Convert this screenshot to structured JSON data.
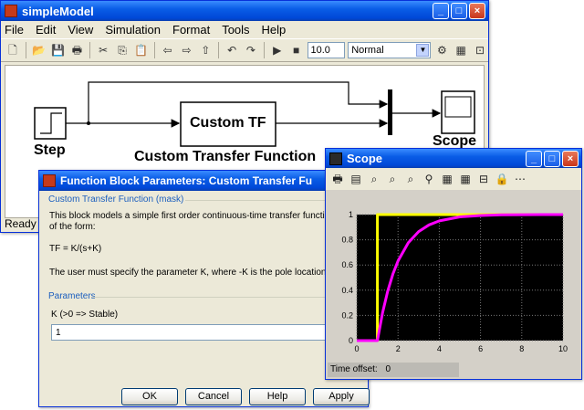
{
  "simulink": {
    "title": "simpleModel",
    "menu": [
      "File",
      "Edit",
      "View",
      "Simulation",
      "Format",
      "Tools",
      "Help"
    ],
    "stop_time": "10.0",
    "sim_mode": "Normal",
    "status": "Ready",
    "blocks": {
      "step_label": "Step",
      "tf_block_text": "Custom TF",
      "tf_label": "Custom Transfer Function",
      "scope_label": "Scope"
    }
  },
  "dialog": {
    "title": "Function Block Parameters: Custom Transfer Fu",
    "section_title": "Custom Transfer Function (mask)",
    "desc_line1": "This block models a simple first order continuous-time transfer function",
    "desc_line2": "of the form:",
    "formula": "TF = K/(s+K)",
    "note": "The user must specify the parameter K, where -K is the pole location.",
    "params_title": "Parameters",
    "param_label": "K (>0 => Stable)",
    "param_value": "1",
    "buttons": {
      "ok": "OK",
      "cancel": "Cancel",
      "help": "Help",
      "apply": "Apply"
    }
  },
  "scope": {
    "title": "Scope",
    "time_offset_label": "Time offset:",
    "time_offset_value": "0",
    "icons": [
      "print-icon",
      "params-icon",
      "zoom-icon",
      "zoom-x-icon",
      "zoom-y-icon",
      "autoscale-icon",
      "save-axes-icon",
      "restore-axes-icon",
      "floating-icon",
      "lock-icon",
      "signal-select-icon"
    ]
  },
  "chart_data": {
    "type": "line",
    "xlim": [
      0,
      10
    ],
    "ylim": [
      0,
      1
    ],
    "xticks": [
      "0",
      "2",
      "4",
      "6",
      "8",
      "10"
    ],
    "yticks": [
      "0",
      "0.2",
      "0.4",
      "0.6",
      "0.8",
      "1"
    ],
    "grid": true,
    "background": "#000000",
    "series": [
      {
        "color": "#ffff00",
        "x": [
          0,
          1,
          1,
          10
        ],
        "y": [
          0,
          0,
          1,
          1
        ]
      },
      {
        "color": "#ff00ff",
        "x": [
          0,
          1,
          1.25,
          1.5,
          1.75,
          2,
          2.5,
          3,
          3.5,
          4,
          5,
          6,
          7,
          8,
          9,
          10
        ],
        "y": [
          0,
          0,
          0.221,
          0.393,
          0.528,
          0.632,
          0.777,
          0.865,
          0.918,
          0.95,
          0.982,
          0.993,
          0.998,
          0.999,
          1,
          1
        ]
      }
    ]
  }
}
